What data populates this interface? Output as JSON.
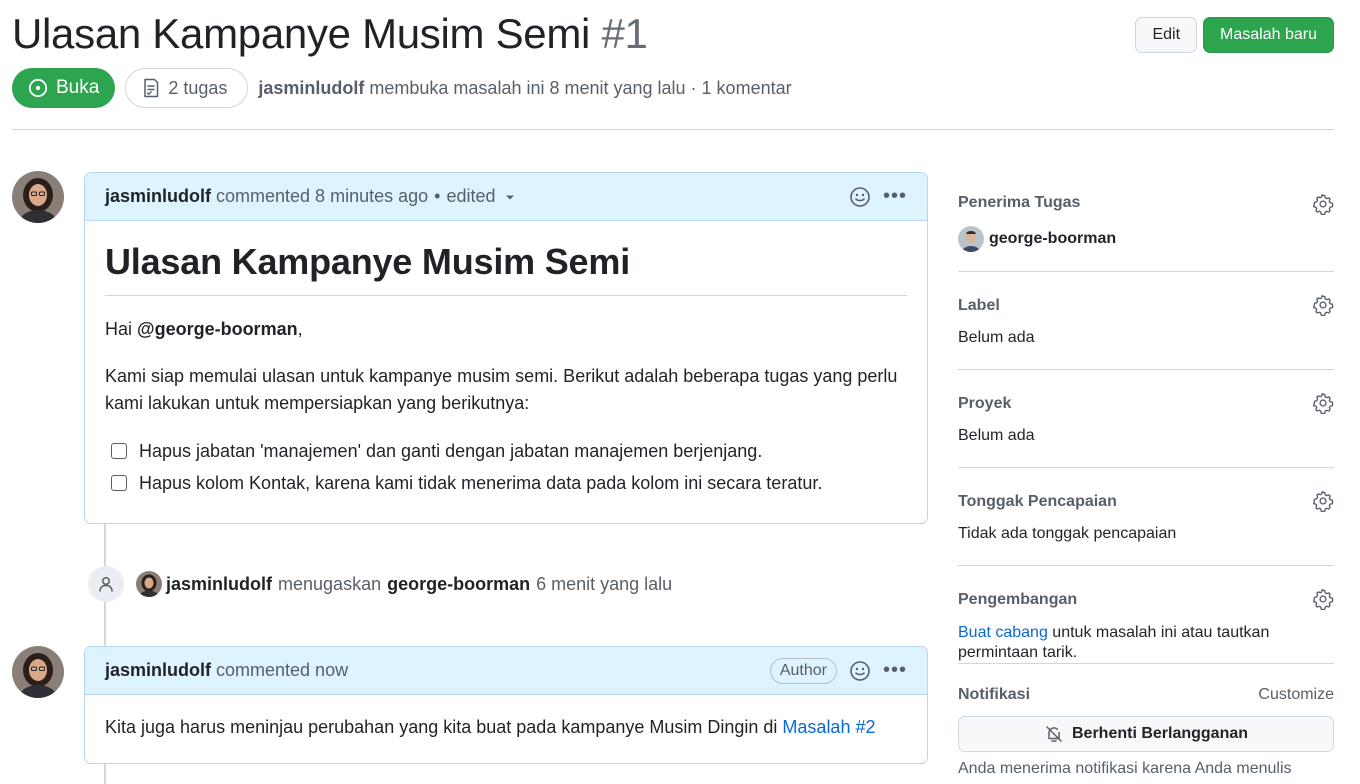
{
  "header": {
    "title": "Ulasan Kampanye Musim Semi",
    "number": "#1",
    "edit_label": "Edit",
    "new_issue_label": "Masalah baru",
    "state_label": "Buka",
    "tasks_label": "2 tugas",
    "author": "jasminludolf",
    "opened_text": "membuka masalah ini 8 menit yang lalu · 1 komentar"
  },
  "comment1": {
    "author": "jasminludolf",
    "meta": "commented 8 minutes ago",
    "edited": "edited",
    "heading": "Ulasan Kampanye Musim Semi",
    "greeting_prefix": "Hai ",
    "mention": "@george-boorman",
    "greeting_suffix": ",",
    "paragraph": "Kami siap memulai ulasan untuk kampanye musim semi. Berikut adalah beberapa tugas yang perlu kami lakukan untuk mempersiapkan yang berikutnya:",
    "tasks": [
      "Hapus jabatan 'manajemen' dan ganti dengan jabatan manajemen berjenjang.",
      "Hapus kolom Kontak, karena kami tidak menerima data pada kolom ini secara teratur."
    ]
  },
  "event": {
    "actor": "jasminludolf",
    "action": "menugaskan",
    "target": "george-boorman",
    "time": "6 menit yang lalu"
  },
  "comment2": {
    "author": "jasminludolf",
    "meta": "commented now",
    "badge": "Author",
    "text": "Kita juga harus meninjau perubahan yang kita buat pada kampanye Musim Dingin di ",
    "link": "Masalah #2"
  },
  "sidebar": {
    "assignees_title": "Penerima Tugas",
    "assignee": "george-boorman",
    "labels_title": "Label",
    "labels_value": "Belum ada",
    "projects_title": "Proyek",
    "projects_value": "Belum ada",
    "milestone_title": "Tonggak Pencapaian",
    "milestone_value": "Tidak ada tonggak pencapaian",
    "development_title": "Pengembangan",
    "development_link": "Buat cabang",
    "development_text_1": " untuk masalah ini atau tautkan",
    "development_text_2": "permintaan tarik.",
    "notifications_title": "Notifikasi",
    "customize_label": "Customize",
    "unsubscribe_label": "Berhenti Berlangganan",
    "notification_note": "Anda menerima notifikasi karena Anda menulis"
  },
  "colors": {
    "primary_green": "#2da44e",
    "comment_header_blue": "#ddf4ff",
    "link_blue": "#0969da"
  }
}
